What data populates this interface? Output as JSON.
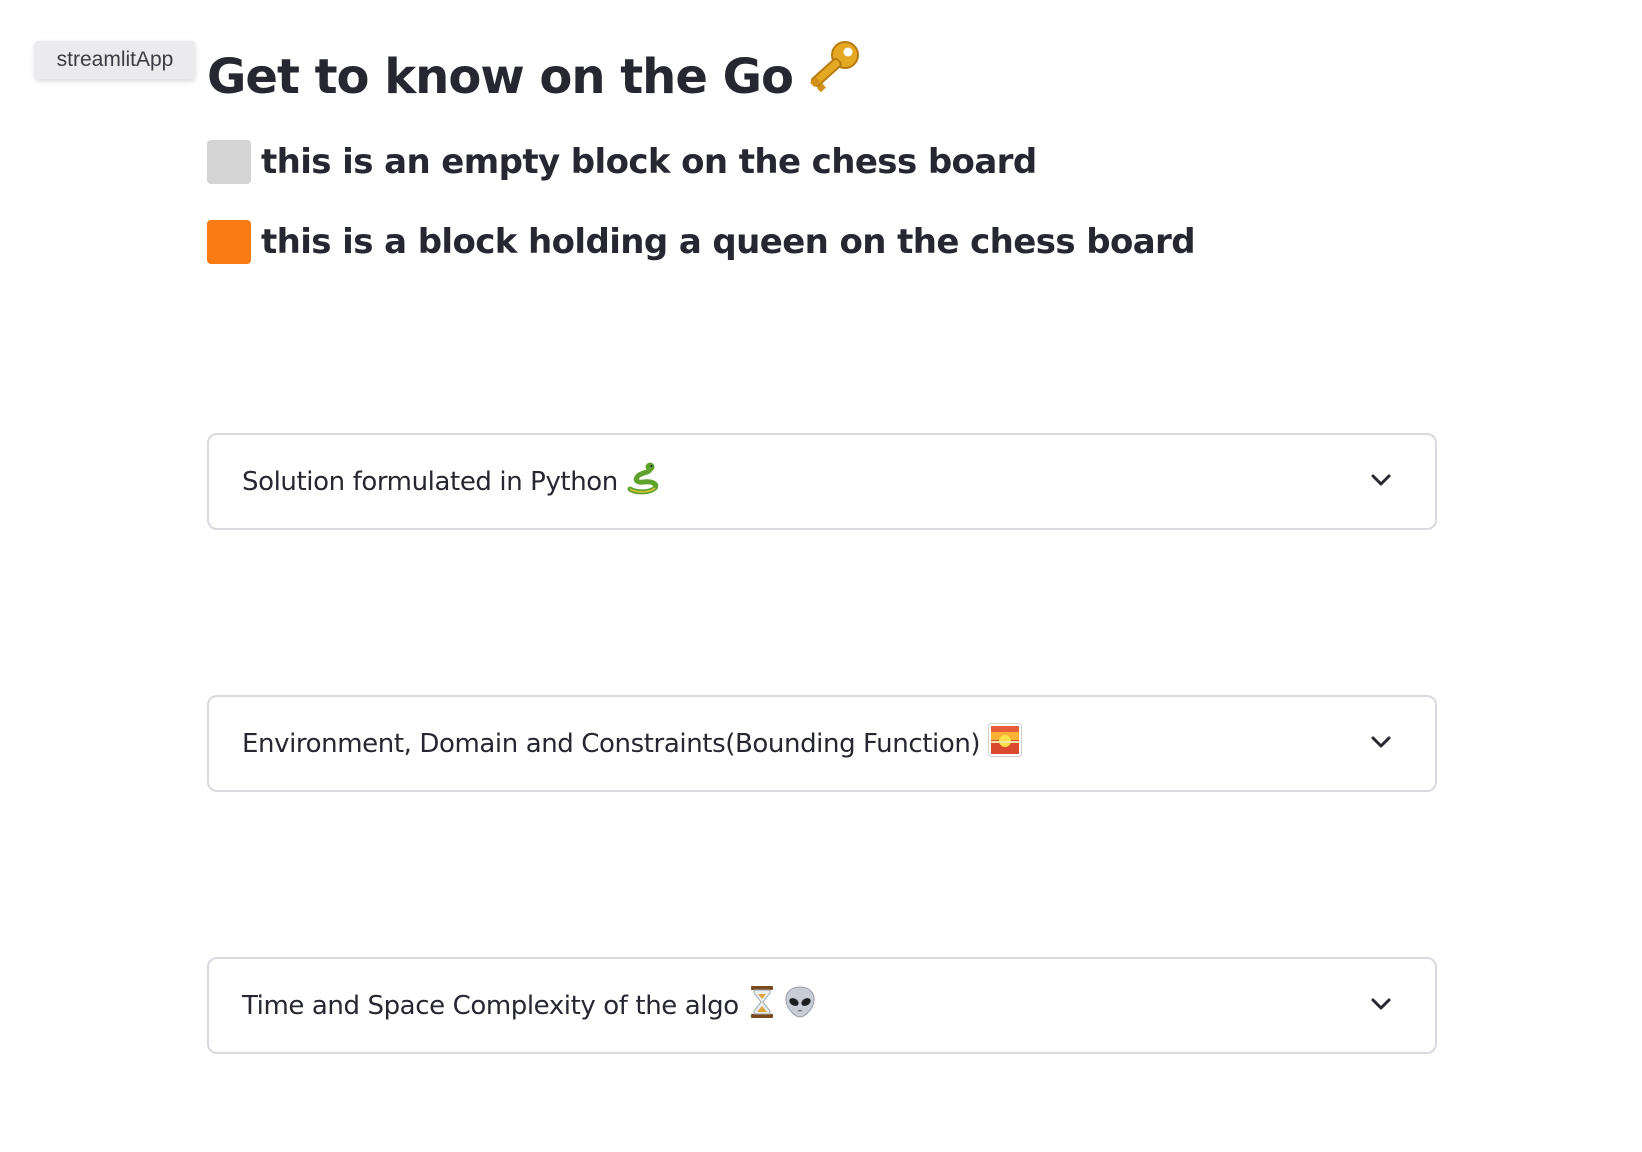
{
  "app_badge": {
    "label": "streamlitApp"
  },
  "header": {
    "title": "Get to know on the Go",
    "title_icon": "key-icon"
  },
  "legend": [
    {
      "text": "this is an empty block on the chess board",
      "swatch_color": "#d4d4d4",
      "icon": "empty-block-swatch"
    },
    {
      "text": "this is a block holding a queen on the chess board",
      "swatch_color": "#f97b14",
      "icon": "queen-block-swatch"
    }
  ],
  "expanders": [
    {
      "label": "Solution formulated in Python",
      "icons": [
        "snake-icon"
      ],
      "expanded": false
    },
    {
      "label": "Environment, Domain and Constraints(Bounding Function)",
      "icons": [
        "sunrise-icon"
      ],
      "expanded": false
    },
    {
      "label": "Time and Space Complexity of the algo",
      "icons": [
        "hourglass-icon",
        "alien-icon"
      ],
      "expanded": false
    }
  ],
  "colors": {
    "text": "#262730",
    "expander_border": "#d8dae0",
    "badge_bg": "#ebebed"
  }
}
